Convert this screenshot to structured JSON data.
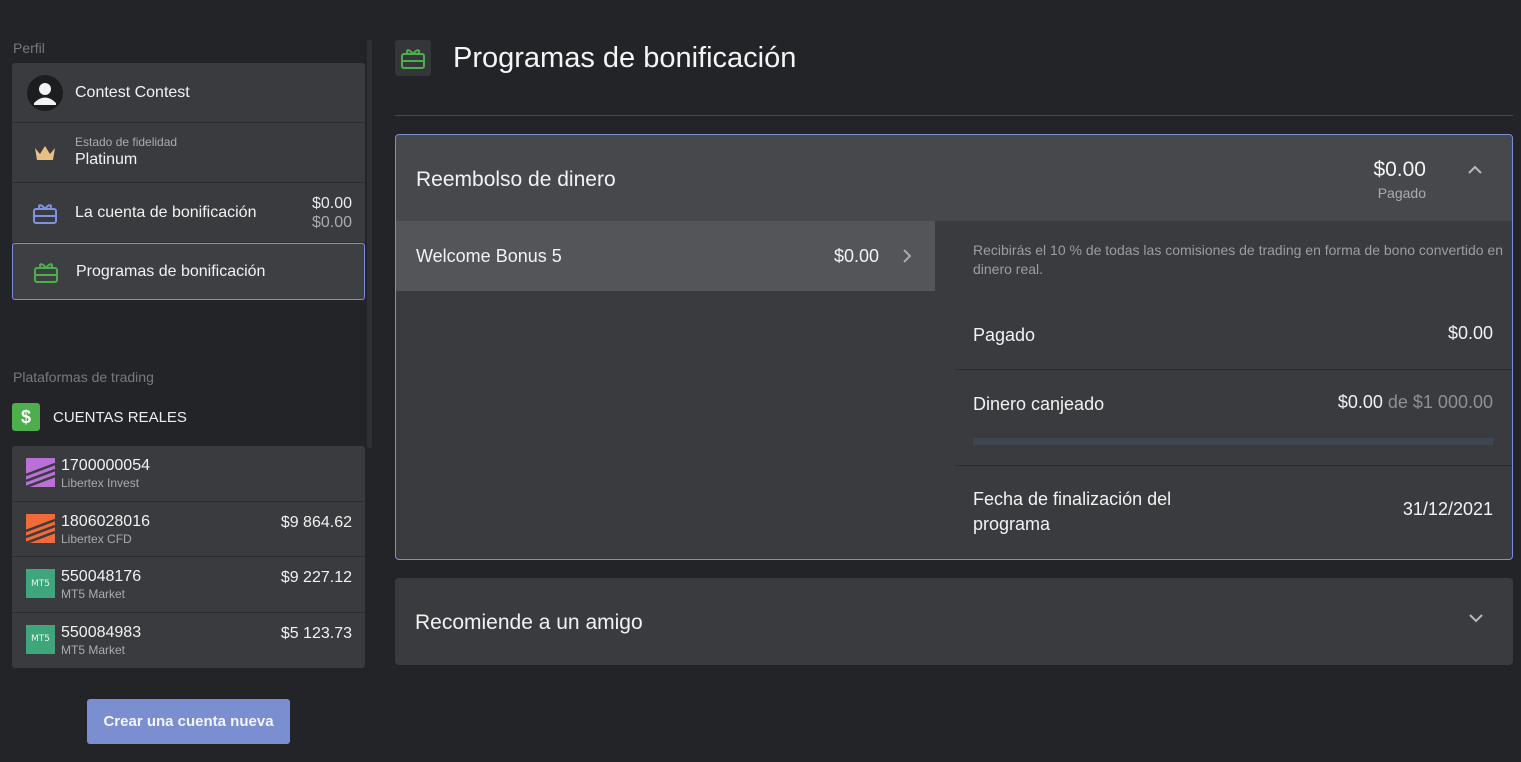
{
  "sidebar": {
    "profile_label": "Perfil",
    "profile": {
      "name": "Contest Contest",
      "loyalty_label": "Estado de fidelidad",
      "loyalty_value": "Platinum",
      "bonus_account_label": "La cuenta de bonificación",
      "bonus_account_amount": "$0.00",
      "bonus_account_amount_secondary": "$0.00",
      "bonus_programs_label": "Programas de bonificación"
    },
    "platforms_label": "Plataformas de trading",
    "real_accounts_label": "CUENTAS REALES",
    "dollar_symbol": "$",
    "accounts": [
      {
        "number": "1700000054",
        "type": "Libertex Invest",
        "balance": "",
        "logo": "libertex-invest-logo"
      },
      {
        "number": "1806028016",
        "type": "Libertex CFD",
        "balance": "$9 864.62",
        "logo": "libertex-cfd-logo"
      },
      {
        "number": "550048176",
        "type": "MT5 Market",
        "balance": "$9 227.12",
        "logo": "mt5-logo"
      },
      {
        "number": "550084983",
        "type": "MT5 Market",
        "balance": "$5 123.73",
        "logo": "mt5-logo"
      }
    ],
    "mt5_text": "MT5",
    "create_account_button": "Crear una cuenta nueva"
  },
  "main": {
    "page_title": "Programas de bonificación",
    "cashback_card": {
      "title": "Reembolso de dinero",
      "amount": "$0.00",
      "amount_label": "Pagado",
      "item": {
        "name": "Welcome Bonus 5",
        "amount": "$0.00"
      },
      "description": "Recibirás el 10 % de todas las comisiones de trading en forma de bono convertido en dinero real.",
      "paid_label": "Pagado",
      "paid_value": "$0.00",
      "redeemed_label": "Dinero canjeado",
      "redeemed_value": "$0.00",
      "redeemed_of": "de $1 000.00",
      "redeemed_progress": 0,
      "end_date_label": "Fecha de finalización del programa",
      "end_date_value": "31/12/2021"
    },
    "referral_card": {
      "title": "Recomiende a un amigo"
    }
  },
  "colors": {
    "background": "#232427",
    "panel": "#3a3b3e",
    "accent": "#7b8fd6",
    "button": "#7a8ed0",
    "green": "#4cae4c"
  }
}
